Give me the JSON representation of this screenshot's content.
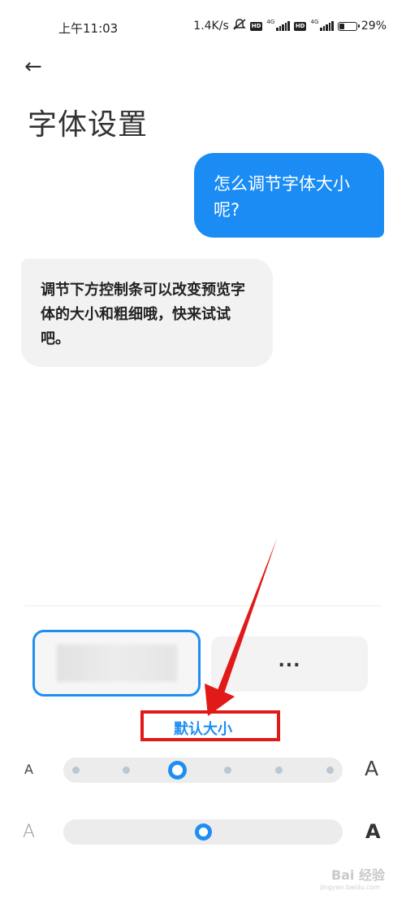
{
  "status_bar": {
    "time": "上午11:03",
    "network_speed": "1.4K/s",
    "signal1_badge": "HD",
    "signal1_net": "4G",
    "signal2_badge": "HD",
    "signal2_net": "4G",
    "battery_percent": "29%",
    "battery_level": 0.29,
    "icons": [
      "muted-bell-icon",
      "hd-icon",
      "signal-icon",
      "hd-icon",
      "signal-icon",
      "battery-icon"
    ]
  },
  "header": {
    "back_icon": "left-arrow-icon",
    "back_glyph": "←",
    "title": "字体设置"
  },
  "chat": {
    "question": "怎么调节字体大小呢?",
    "answer": "调节下方控制条可以改变预览字体的大小和粗细哦，快来试试吧。"
  },
  "font_options": {
    "more_label": "...",
    "selected_index": 0
  },
  "size_slider": {
    "label": "默认大小",
    "small_label": "A",
    "large_label": "A",
    "steps": 6,
    "value_index": 2
  },
  "weight_slider": {
    "small_label": "A",
    "large_label": "A",
    "value": 0.5
  },
  "watermark": {
    "text": "Bai 经验",
    "subtext": "jingyan.baidu.com"
  },
  "colors": {
    "accent": "#1f8ef1",
    "bubble_out": "#1a8cf3",
    "bubble_in": "#f2f2f2",
    "highlight": "#e21919"
  }
}
